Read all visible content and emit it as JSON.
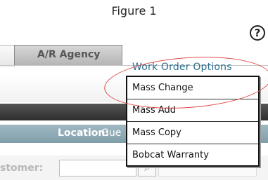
{
  "caption": "Figure 1",
  "help_icon": {
    "glyph": "?",
    "icon": "question-mark-icon"
  },
  "tabs": [
    {
      "label": ""
    },
    {
      "label": "A/R Agency"
    }
  ],
  "work_order_options": {
    "label": "Work Order Options"
  },
  "menu": {
    "items": [
      {
        "label": "Mass Change"
      },
      {
        "label": "Mass Add"
      },
      {
        "label": "Mass Copy"
      },
      {
        "label": "Bobcat Warranty"
      }
    ]
  },
  "location": {
    "label": "Location:",
    "value": "Gue"
  },
  "customer": {
    "label": "stomer:"
  },
  "lookup": {
    "icon": "search-icon",
    "glyph": "⌕"
  },
  "colors": {
    "accent_link": "#2c6e8e",
    "highlight": "#e04a4a",
    "location_bar": "#8fa9b4",
    "dark_bar": "#3a3a3a"
  }
}
